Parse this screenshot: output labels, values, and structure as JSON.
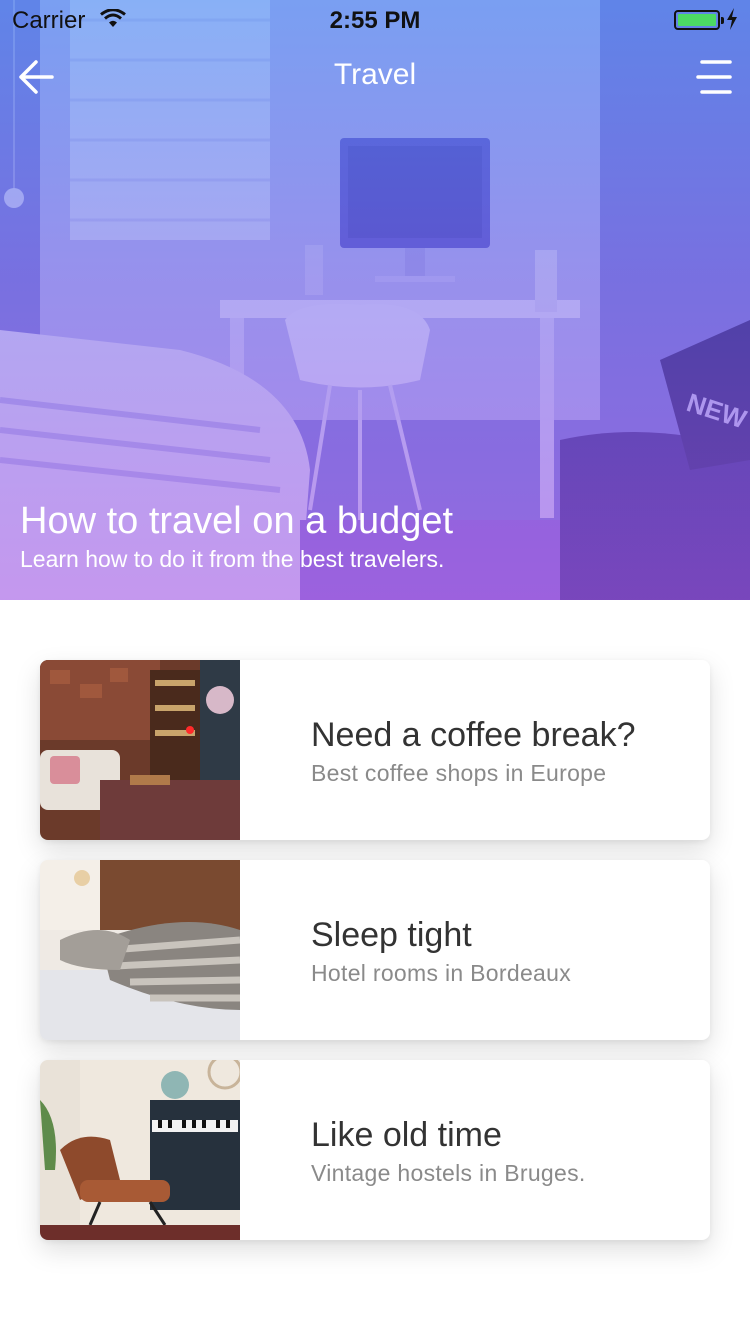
{
  "status_bar": {
    "carrier": "Carrier",
    "time": "2:55 PM",
    "wifi_icon": "wifi-icon",
    "battery_icon": "battery-icon",
    "battery_level": 1.0,
    "charging_icon": "bolt-icon"
  },
  "nav": {
    "title": "Travel",
    "back_icon": "arrow-left-icon",
    "menu_icon": "hamburger-menu-icon"
  },
  "hero": {
    "title": "How to travel on a budget",
    "subtitle": "Learn how to do it from the best travelers.",
    "image": "bedroom-desk-photo"
  },
  "cards": [
    {
      "title": "Need a coffee break?",
      "subtitle": "Best coffee shops in Europe",
      "image": "living-room-photo"
    },
    {
      "title": "Sleep tight",
      "subtitle": "Hotel rooms in Bordeaux",
      "image": "bed-pillows-photo"
    },
    {
      "title": "Like old time",
      "subtitle": "Vintage hostels in Bruges.",
      "image": "lounge-chair-piano-photo"
    }
  ],
  "colors": {
    "gradient_top": "#4d8ef0",
    "gradient_bottom": "#a75fe4",
    "card_title": "#333333",
    "card_subtitle": "#8a8a8a"
  }
}
